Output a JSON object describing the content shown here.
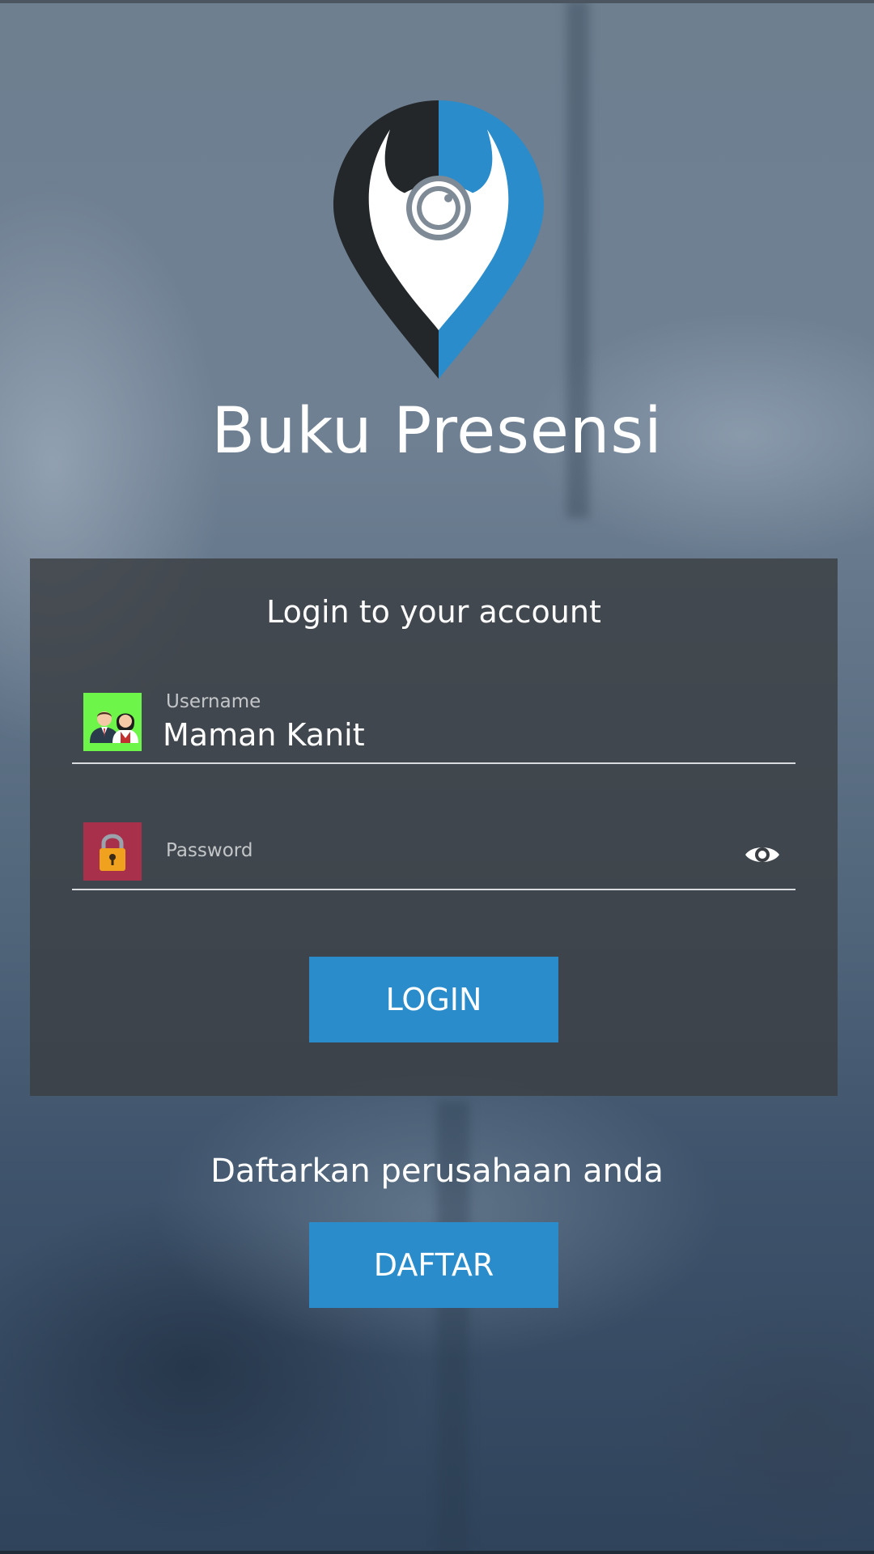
{
  "app": {
    "title": "Buku Presensi"
  },
  "login_card": {
    "heading": "Login to your account",
    "username": {
      "label": "Username",
      "value": "Maman Kanit"
    },
    "password": {
      "label": "Password",
      "value": ""
    },
    "login_button": "LOGIN"
  },
  "register": {
    "prompt": "Daftarkan perusahaan anda",
    "button": "DAFTAR"
  },
  "icons": {
    "logo": "location-pin-camera-logo",
    "username": "users-couple-icon",
    "password": "padlock-icon",
    "toggle_password": "eye-icon"
  },
  "colors": {
    "accent": "#2a8ccb",
    "logo_dark": "#23272a",
    "logo_blue": "#2a8ccb",
    "user_icon_bg": "#6ef54a",
    "lock_icon_bg": "#a8304a",
    "lock_body": "#f0a21e"
  }
}
